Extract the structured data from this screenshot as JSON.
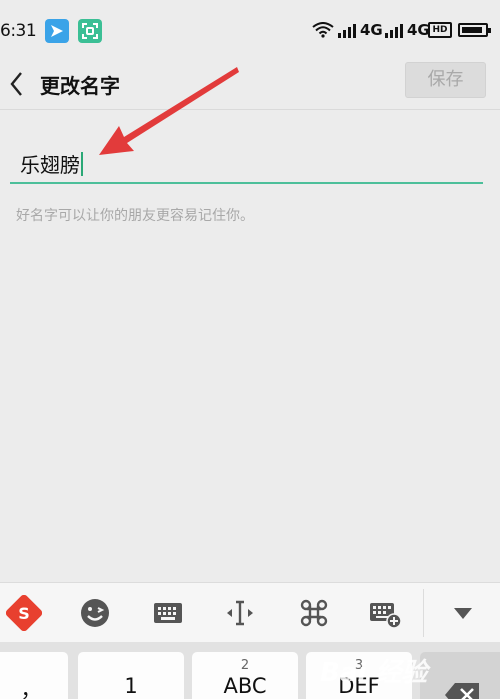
{
  "status_bar": {
    "time": "6:31",
    "network_1": "4G",
    "network_2": "4G",
    "hd_badge": "HD"
  },
  "header": {
    "back_icon": "chevron-left-icon",
    "title": "更改名字",
    "save_label": "保存",
    "save_enabled": false
  },
  "name_field": {
    "value": "乐翅膀",
    "hint": "好名字可以让你的朋友更容易记住你。",
    "accent_color": "#4cbf9a"
  },
  "annotation": {
    "arrow_color": "#e23b3b",
    "arrow_icon": "red-arrow-icon"
  },
  "keyboard": {
    "toolbar": [
      "sogou-logo-icon",
      "emoji-icon",
      "keyboard-icon",
      "cursor-move-icon",
      "command-icon",
      "keyboard-settings-icon",
      "collapse-keyboard-icon"
    ],
    "keys": [
      {
        "main": "，",
        "sub": ""
      },
      {
        "main": "1",
        "sub": ""
      },
      {
        "main": "ABC",
        "sub": "2"
      },
      {
        "main": "DEF",
        "sub": "3"
      },
      {
        "main": "",
        "sub": "",
        "icon": "backspace-icon"
      }
    ],
    "watermark": "Bai 经验"
  }
}
